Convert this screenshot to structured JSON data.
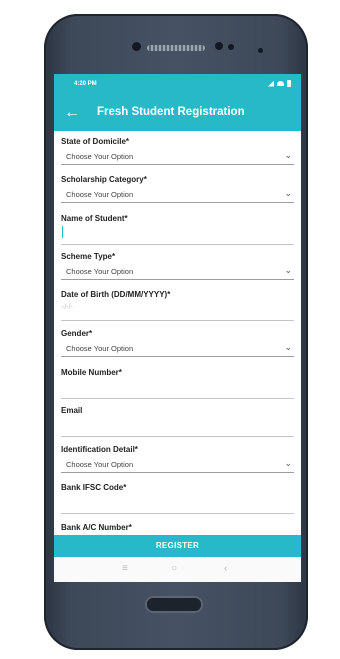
{
  "status_bar": {
    "time": "4:20 PM"
  },
  "app_bar": {
    "back_icon": "arrow-left-icon",
    "title": "Fresh Student Registration"
  },
  "form": {
    "fields": [
      {
        "label": "State of Domicile*",
        "type": "select",
        "value": "Choose Your Option"
      },
      {
        "label": "Scholarship Category*",
        "type": "select",
        "value": "Choose Your Option"
      },
      {
        "label": "Name of Student*",
        "type": "input",
        "value": ""
      },
      {
        "label": "Scheme Type*",
        "type": "select",
        "value": "Choose Your Option"
      },
      {
        "label": "Date of Birth (DD/MM/YYYY)*",
        "type": "date",
        "placeholder": "-/-/-"
      },
      {
        "label": "Gender*",
        "type": "select",
        "value": "Choose Your Option"
      },
      {
        "label": "Mobile Number*",
        "type": "input",
        "value": ""
      },
      {
        "label": "Email",
        "type": "input",
        "value": ""
      },
      {
        "label": "Identification Detail*",
        "type": "select",
        "value": "Choose Your Option"
      },
      {
        "label": "Bank IFSC Code*",
        "type": "input",
        "value": ""
      },
      {
        "label": "Bank A/C Number*",
        "type": "input",
        "value": ""
      }
    ]
  },
  "register_button": {
    "label": "REGISTER"
  },
  "nav_bar": {
    "recent": "recent-apps-icon",
    "home": "home-icon",
    "back": "back-triangle-icon"
  },
  "colors": {
    "accent": "#27b9c8"
  }
}
